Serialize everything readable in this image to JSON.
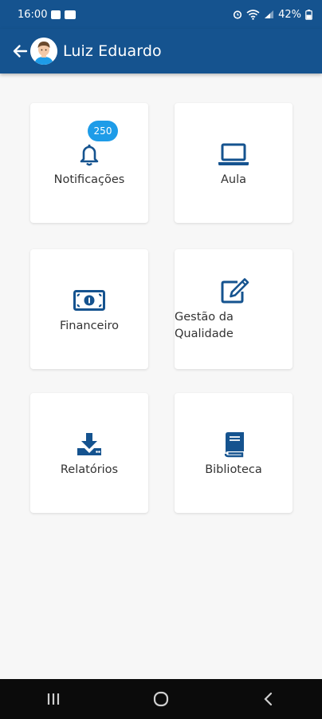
{
  "status_bar": {
    "time": "16:00",
    "battery": "42%"
  },
  "app_bar": {
    "user_name": "Luiz Eduardo"
  },
  "menu": [
    {
      "label": "Notificações",
      "icon": "bell-icon",
      "badge": "250"
    },
    {
      "label": "Aula",
      "icon": "laptop-icon"
    },
    {
      "label_lines": [
        "Gestão da",
        "Qualidade"
      ],
      "icon": "edit-icon"
    },
    {
      "label": "Financeiro",
      "icon": "money-icon"
    },
    {
      "label": "Relatórios",
      "icon": "download-icon"
    },
    {
      "label": "Biblioteca",
      "icon": "book-icon"
    }
  ],
  "colors": {
    "primary": "#15538f",
    "badge": "#1e9ce8",
    "background": "#f7f7f7"
  }
}
